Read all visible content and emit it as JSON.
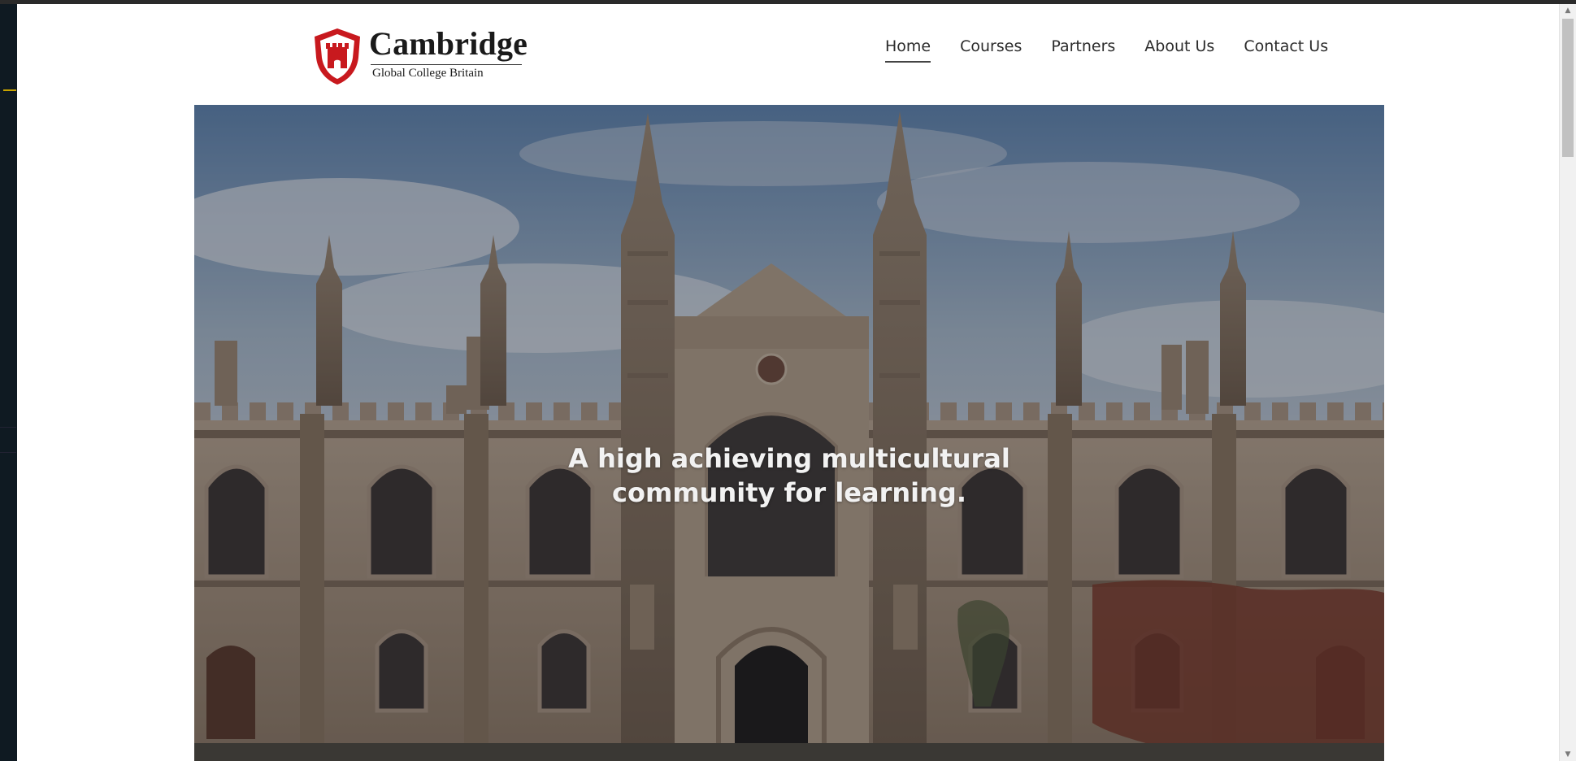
{
  "site": {
    "logo": {
      "name": "Cambridge",
      "subtitle": "Global College Britain",
      "shield_color": "#c8191e"
    },
    "nav": [
      {
        "label": "Home",
        "active": true
      },
      {
        "label": "Courses",
        "active": false
      },
      {
        "label": "Partners",
        "active": false
      },
      {
        "label": "About Us",
        "active": false
      },
      {
        "label": "Contact Us",
        "active": false
      }
    ]
  },
  "hero": {
    "title_line1": "A high achieving multicultural",
    "title_line2": "community for learning."
  }
}
